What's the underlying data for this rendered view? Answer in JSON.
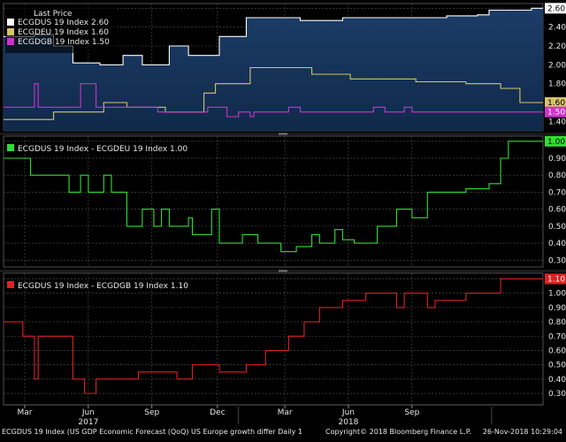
{
  "chart_data": [
    {
      "type": "line",
      "legend_title": "Last Price",
      "legend_placement": "top-left",
      "ylim": [
        1.3,
        2.65
      ],
      "yticks": [
        "1.40",
        "1.60",
        "1.80",
        "2.00",
        "2.20",
        "2.40",
        "2.60"
      ],
      "series": [
        {
          "name": "ECGDUS 19 Index",
          "last_label": "2.60",
          "color": "#ffffff",
          "points": [
            [
              0,
              2.3
            ],
            [
              0.8,
              2.3
            ],
            [
              0.8,
              2.32
            ],
            [
              1.3,
              2.32
            ],
            [
              1.3,
              2.2
            ],
            [
              1.8,
              2.2
            ],
            [
              1.8,
              2.02
            ],
            [
              2.5,
              2.02
            ],
            [
              2.5,
              2.0
            ],
            [
              3.1,
              2.0
            ],
            [
              3.1,
              2.1
            ],
            [
              3.6,
              2.1
            ],
            [
              3.6,
              2.0
            ],
            [
              4.3,
              2.0
            ],
            [
              4.3,
              2.2
            ],
            [
              4.8,
              2.2
            ],
            [
              4.8,
              2.1
            ],
            [
              5.6,
              2.1
            ],
            [
              5.6,
              2.3
            ],
            [
              6.3,
              2.3
            ],
            [
              6.3,
              2.5
            ],
            [
              7.7,
              2.5
            ],
            [
              7.7,
              2.47
            ],
            [
              8.8,
              2.47
            ],
            [
              8.8,
              2.5
            ],
            [
              11.5,
              2.5
            ],
            [
              11.5,
              2.52
            ],
            [
              12.3,
              2.52
            ],
            [
              12.3,
              2.53
            ],
            [
              12.6,
              2.53
            ],
            [
              12.6,
              2.58
            ],
            [
              13.7,
              2.58
            ],
            [
              13.7,
              2.6
            ],
            [
              14.0,
              2.6
            ]
          ]
        },
        {
          "name": "ECGDEU 19 Index",
          "last_label": "1.60",
          "color": "#d8c36a",
          "points": [
            [
              0,
              1.42
            ],
            [
              1.3,
              1.42
            ],
            [
              1.3,
              1.5
            ],
            [
              2.6,
              1.5
            ],
            [
              2.6,
              1.6
            ],
            [
              3.2,
              1.6
            ],
            [
              3.2,
              1.55
            ],
            [
              4.2,
              1.55
            ],
            [
              4.2,
              1.5
            ],
            [
              5.2,
              1.5
            ],
            [
              5.2,
              1.7
            ],
            [
              5.5,
              1.7
            ],
            [
              5.5,
              1.8
            ],
            [
              6.4,
              1.8
            ],
            [
              6.4,
              1.97
            ],
            [
              8.0,
              1.97
            ],
            [
              8.0,
              1.9
            ],
            [
              9.0,
              1.9
            ],
            [
              9.0,
              1.85
            ],
            [
              10.7,
              1.85
            ],
            [
              10.7,
              1.82
            ],
            [
              12.0,
              1.82
            ],
            [
              12.0,
              1.8
            ],
            [
              12.9,
              1.8
            ],
            [
              12.9,
              1.75
            ],
            [
              13.4,
              1.75
            ],
            [
              13.4,
              1.6
            ],
            [
              14.0,
              1.6
            ]
          ]
        },
        {
          "name": "ECGDGB 19 Index",
          "last_label": "1.50",
          "color": "#cc33cc",
          "points": [
            [
              0,
              1.55
            ],
            [
              0.8,
              1.55
            ],
            [
              0.8,
              1.8
            ],
            [
              0.9,
              1.8
            ],
            [
              0.9,
              1.55
            ],
            [
              2.0,
              1.55
            ],
            [
              2.0,
              1.8
            ],
            [
              2.4,
              1.8
            ],
            [
              2.4,
              1.55
            ],
            [
              4.0,
              1.55
            ],
            [
              4.0,
              1.5
            ],
            [
              5.3,
              1.5
            ],
            [
              5.3,
              1.55
            ],
            [
              5.8,
              1.55
            ],
            [
              5.8,
              1.45
            ],
            [
              6.1,
              1.45
            ],
            [
              6.1,
              1.5
            ],
            [
              6.4,
              1.5
            ],
            [
              6.4,
              1.45
            ],
            [
              6.5,
              1.45
            ],
            [
              6.5,
              1.5
            ],
            [
              7.4,
              1.5
            ],
            [
              7.4,
              1.55
            ],
            [
              7.7,
              1.55
            ],
            [
              7.7,
              1.5
            ],
            [
              9.6,
              1.5
            ],
            [
              9.6,
              1.55
            ],
            [
              9.9,
              1.55
            ],
            [
              9.9,
              1.5
            ],
            [
              10.4,
              1.5
            ],
            [
              10.4,
              1.55
            ],
            [
              10.6,
              1.55
            ],
            [
              10.6,
              1.5
            ],
            [
              14.0,
              1.5
            ]
          ]
        }
      ]
    },
    {
      "type": "line",
      "ylim": [
        0.26,
        1.03
      ],
      "yticks": [
        "0.30",
        "0.40",
        "0.50",
        "0.60",
        "0.70",
        "0.80",
        "0.90",
        "1.00"
      ],
      "series": [
        {
          "name": "ECGDUS 19 Index - ECGDEU 19 Index",
          "last_label": "1.00",
          "color": "#33dd33",
          "points": [
            [
              0,
              0.9
            ],
            [
              0.7,
              0.9
            ],
            [
              0.7,
              0.8
            ],
            [
              1.7,
              0.8
            ],
            [
              1.7,
              0.7
            ],
            [
              2.0,
              0.7
            ],
            [
              2.0,
              0.8
            ],
            [
              2.2,
              0.8
            ],
            [
              2.2,
              0.7
            ],
            [
              2.6,
              0.7
            ],
            [
              2.6,
              0.8
            ],
            [
              2.8,
              0.8
            ],
            [
              2.8,
              0.7
            ],
            [
              3.2,
              0.7
            ],
            [
              3.2,
              0.5
            ],
            [
              3.6,
              0.5
            ],
            [
              3.6,
              0.6
            ],
            [
              3.9,
              0.6
            ],
            [
              3.9,
              0.5
            ],
            [
              4.1,
              0.5
            ],
            [
              4.1,
              0.6
            ],
            [
              4.3,
              0.6
            ],
            [
              4.3,
              0.5
            ],
            [
              4.8,
              0.5
            ],
            [
              4.8,
              0.55
            ],
            [
              4.9,
              0.55
            ],
            [
              4.9,
              0.45
            ],
            [
              5.4,
              0.45
            ],
            [
              5.4,
              0.6
            ],
            [
              5.6,
              0.6
            ],
            [
              5.6,
              0.4
            ],
            [
              6.2,
              0.4
            ],
            [
              6.2,
              0.45
            ],
            [
              6.6,
              0.45
            ],
            [
              6.6,
              0.4
            ],
            [
              7.2,
              0.4
            ],
            [
              7.2,
              0.35
            ],
            [
              7.6,
              0.35
            ],
            [
              7.6,
              0.38
            ],
            [
              8.0,
              0.38
            ],
            [
              8.0,
              0.45
            ],
            [
              8.2,
              0.45
            ],
            [
              8.2,
              0.4
            ],
            [
              8.6,
              0.4
            ],
            [
              8.6,
              0.48
            ],
            [
              8.8,
              0.48
            ],
            [
              8.8,
              0.42
            ],
            [
              9.1,
              0.42
            ],
            [
              9.1,
              0.4
            ],
            [
              9.7,
              0.4
            ],
            [
              9.7,
              0.5
            ],
            [
              10.2,
              0.5
            ],
            [
              10.2,
              0.6
            ],
            [
              10.6,
              0.6
            ],
            [
              10.6,
              0.55
            ],
            [
              11.0,
              0.55
            ],
            [
              11.0,
              0.7
            ],
            [
              12.0,
              0.7
            ],
            [
              12.0,
              0.72
            ],
            [
              12.6,
              0.72
            ],
            [
              12.6,
              0.75
            ],
            [
              12.9,
              0.75
            ],
            [
              12.9,
              0.9
            ],
            [
              13.1,
              0.9
            ],
            [
              13.1,
              1.0
            ],
            [
              14.0,
              1.0
            ]
          ]
        }
      ]
    },
    {
      "type": "line",
      "ylim": [
        0.22,
        1.14
      ],
      "yticks": [
        "0.30",
        "0.40",
        "0.50",
        "0.60",
        "0.70",
        "0.80",
        "0.90",
        "1.00",
        "1.10"
      ],
      "series": [
        {
          "name": "ECGDUS 19 Index - ECGDGB 19 Index",
          "last_label": "1.10",
          "color": "#dd2222",
          "points": [
            [
              0,
              0.8
            ],
            [
              0.5,
              0.8
            ],
            [
              0.5,
              0.7
            ],
            [
              0.8,
              0.7
            ],
            [
              0.8,
              0.4
            ],
            [
              0.9,
              0.4
            ],
            [
              0.9,
              0.7
            ],
            [
              1.8,
              0.7
            ],
            [
              1.8,
              0.4
            ],
            [
              2.1,
              0.4
            ],
            [
              2.1,
              0.3
            ],
            [
              2.4,
              0.3
            ],
            [
              2.4,
              0.4
            ],
            [
              3.5,
              0.4
            ],
            [
              3.5,
              0.45
            ],
            [
              4.5,
              0.45
            ],
            [
              4.5,
              0.4
            ],
            [
              4.9,
              0.4
            ],
            [
              4.9,
              0.5
            ],
            [
              5.6,
              0.5
            ],
            [
              5.6,
              0.45
            ],
            [
              6.3,
              0.45
            ],
            [
              6.3,
              0.5
            ],
            [
              6.8,
              0.5
            ],
            [
              6.8,
              0.6
            ],
            [
              7.4,
              0.6
            ],
            [
              7.4,
              0.7
            ],
            [
              7.8,
              0.7
            ],
            [
              7.8,
              0.8
            ],
            [
              8.2,
              0.8
            ],
            [
              8.2,
              0.9
            ],
            [
              8.8,
              0.9
            ],
            [
              8.8,
              0.95
            ],
            [
              9.4,
              0.95
            ],
            [
              9.4,
              1.0
            ],
            [
              10.2,
              1.0
            ],
            [
              10.2,
              0.9
            ],
            [
              10.4,
              0.9
            ],
            [
              10.4,
              1.0
            ],
            [
              11.0,
              1.0
            ],
            [
              11.0,
              0.9
            ],
            [
              11.2,
              0.9
            ],
            [
              11.2,
              0.95
            ],
            [
              12.0,
              0.95
            ],
            [
              12.0,
              1.0
            ],
            [
              12.9,
              1.0
            ],
            [
              12.9,
              1.1
            ],
            [
              14.0,
              1.1
            ]
          ]
        }
      ]
    }
  ],
  "x_axis": {
    "range": [
      0,
      14
    ],
    "ticks": [
      {
        "label": "Mar",
        "pos": 0.55
      },
      {
        "label": "Jun",
        "pos": 2.2
      },
      {
        "label": "Sep",
        "pos": 3.85
      },
      {
        "label": "Dec",
        "pos": 5.55
      },
      {
        "label": "Mar",
        "pos": 7.3
      },
      {
        "label": "Jun",
        "pos": 8.95
      },
      {
        "label": "Sep",
        "pos": 10.6
      }
    ],
    "years": [
      {
        "label": "2017",
        "pos": 2.2
      },
      {
        "label": "2018",
        "pos": 8.95
      }
    ]
  },
  "footer": {
    "left": "ECGDUS 19 Index (US GDP Economic Forecast (QoQ) US Europe growth differ  Daily 1",
    "middle": "Copyright© 2018 Bloomberg Finance L.P.",
    "right": "26-Nov-2018 10:29:04"
  }
}
